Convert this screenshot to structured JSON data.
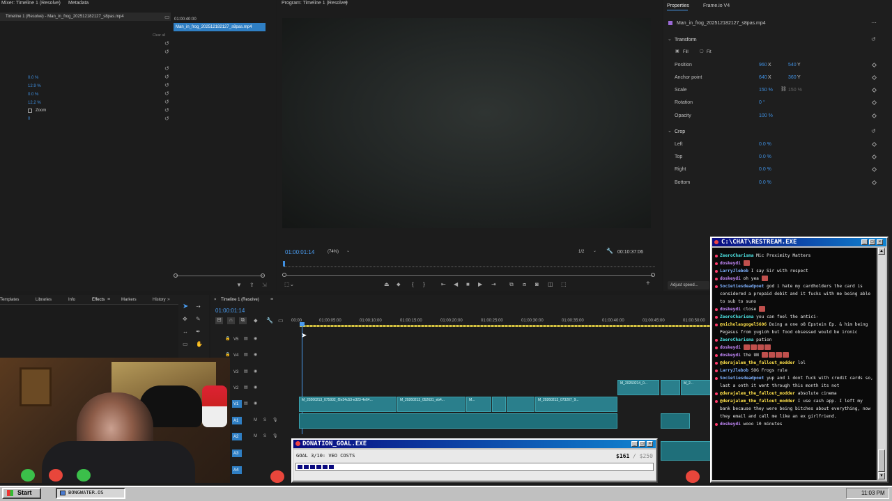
{
  "source_monitor": {
    "tab_mixer": "Mixer: Timeline 1 (Resolve)",
    "tab_metadata": "Metadata",
    "clip_path": "Timeline 1 (Resolve) - Man_in_frog_202512182127_s8pas.mp4",
    "clip_time": "01:00:40:00",
    "clip_name": "Man_in_frog_202512182127_s8pas.mp4",
    "clear_all": "Clear all",
    "values": [
      "0.0 %",
      "12.9 %",
      "0.0 %",
      "12.2 %"
    ],
    "zoom_label": "Zoom",
    "zoom_value": "0"
  },
  "program_monitor": {
    "title": "Program: Timeline 1 (Resolve)",
    "timecode": "01:00:01:14",
    "zoom": "(74%)",
    "resolution": "1/2",
    "duration": "00:10:37:06"
  },
  "properties": {
    "tab_properties": "Properties",
    "tab_frameio": "Frame.io V4",
    "clip_name": "Man_in_frog_202512182127_s8pas.mp4",
    "transform_title": "Transform",
    "fill_label": "Fill",
    "fit_label": "Fit",
    "position_label": "Position",
    "position_x": "960",
    "position_y": "540",
    "anchor_label": "Anchor point",
    "anchor_x": "640",
    "anchor_y": "360",
    "scale_label": "Scale",
    "scale_value": "150 %",
    "scale_linked": "150 %",
    "rotation_label": "Rotation",
    "rotation_value": "0 °",
    "opacity_label": "Opacity",
    "opacity_value": "100 %",
    "crop_title": "Crop",
    "left_label": "Left",
    "left_value": "0.0 %",
    "top_label": "Top",
    "top_value": "0.0 %",
    "right_label": "Right",
    "right_value": "0.0 %",
    "bottom_label": "Bottom",
    "bottom_value": "0.0 %",
    "adjust_speed": "Adjust speed..."
  },
  "bottom_tabs": {
    "templates": "Templates",
    "libraries": "Libraries",
    "info": "Info",
    "effects": "Effects",
    "markers": "Markers",
    "history": "History"
  },
  "timeline": {
    "title": "Timeline 1 (Resolve)",
    "timecode": "01:00:01:14",
    "ruler": [
      "00:00",
      "01:00:05:00",
      "01:00:10:00",
      "01:00:15:00",
      "01:00:20:00",
      "01:00:25:00",
      "01:00:30:00",
      "01:00:35:00",
      "01:00:40:00",
      "01:00:45:00",
      "01:00:50:00"
    ],
    "tracks": [
      "V5",
      "V4",
      "V3",
      "V2",
      "V1",
      "A1",
      "A2",
      "A3",
      "A4"
    ],
    "clips": [
      "M_20260213_075932_f2e34c53-e323-4e64...",
      "M_20260213_052631_eb4...",
      "M...",
      "M_20260213_073207_9...",
      "M_20260214_0...",
      "M_2..."
    ]
  },
  "chat": {
    "title": "C:\\CHAT\\RESTREAM.EXE",
    "messages": [
      {
        "name": "ZeeroCharisma",
        "color": "#4fe8e8",
        "text": "Mic Proximity Matters"
      },
      {
        "name": "doskeydi",
        "color": "#c78bff",
        "text": ""
      },
      {
        "name": "LarryJlebob",
        "color": "#7fb2ff",
        "text": "I say Sir with respect"
      },
      {
        "name": "doskeydi",
        "color": "#c78bff",
        "text": "oh yea"
      },
      {
        "name": "Societiesdeadpoet",
        "color": "#7fb2ff",
        "text": "god i hate my cardholders the card is considered a prepaid debit and it fucks with me being able to sub to suno"
      },
      {
        "name": "doskeydi",
        "color": "#c78bff",
        "text": "close"
      },
      {
        "name": "ZeeroCharisma",
        "color": "#4fe8e8",
        "text": "you can feel the antici-"
      },
      {
        "name": "@nicholasgogel5606",
        "color": "#ffe14a",
        "text": "Doing a one o8 Epstein Ep. & him being Pegasus from yugioh but food obsessed would be ironic"
      },
      {
        "name": "ZeeroCharisma",
        "color": "#4fe8e8",
        "text": "pation"
      },
      {
        "name": "doskeydi",
        "color": "#c78bff",
        "text": ""
      },
      {
        "name": "doskeydi",
        "color": "#c78bff",
        "text": "the UN"
      },
      {
        "name": "@derajalem_the_fallout_modder",
        "color": "#ffe14a",
        "text": "lol"
      },
      {
        "name": "LarryJlebob",
        "color": "#7fb2ff",
        "text": "SOG Frogs rule"
      },
      {
        "name": "Societiesdeadpoet",
        "color": "#7fb2ff",
        "text": "yup and i dont fuck with credit cards so, last a onth it went through this month its not"
      },
      {
        "name": "@derajalem_the_fallout_modder",
        "color": "#ffe14a",
        "text": "absolute cinema"
      },
      {
        "name": "@derajalem_the_fallout_modder",
        "color": "#ffe14a",
        "text": "I use cash app. I left my bank because they were being bitches about everything, now they email and call me like an ex girlfriend."
      },
      {
        "name": "doskeydi",
        "color": "#c78bff",
        "text": "wooo 10 minutes"
      }
    ]
  },
  "donation": {
    "title": "DONATION_GOAL.EXE",
    "goal_label": "GOAL 3/10: VEO COSTS",
    "amount": "$161",
    "target": "/ $250",
    "progress_fraction": 0.644,
    "segments_filled": 6
  },
  "taskbar": {
    "start_label": "Start",
    "task_label": "BONGWATER.OS",
    "clock": "11:03 PM"
  },
  "colors": {
    "premiere_bg": "#1d1d1d",
    "accent_blue": "#3f8fe0",
    "clip_teal": "#2a7f8c",
    "win95_blue": "#0a0a80",
    "taskbar_grey": "#c0c0c0"
  }
}
